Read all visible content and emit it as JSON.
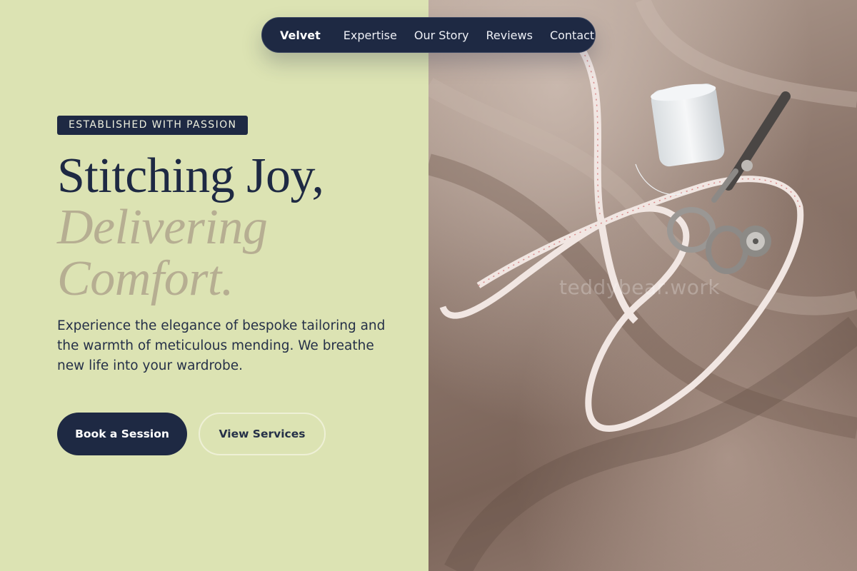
{
  "nav": {
    "brand": "Velvet",
    "links": [
      "Expertise",
      "Our Story",
      "Reviews",
      "Contact"
    ]
  },
  "hero": {
    "badge": "ESTABLISHED WITH PASSION",
    "headline_line1": "Stitching Joy,",
    "headline_line2": "Delivering",
    "headline_line3": "Comfort.",
    "description": "Experience the elegance of bespoke tailoring and the warmth of meticulous mending. We breathe new life into your wardrobe.",
    "primary_cta": "Book a Session",
    "secondary_cta": "View Services"
  },
  "image": {
    "watermark": "teddybear.work"
  },
  "colors": {
    "background": "#dce3b3",
    "navy": "#1e2943",
    "accent_text": "#b6ae92"
  }
}
